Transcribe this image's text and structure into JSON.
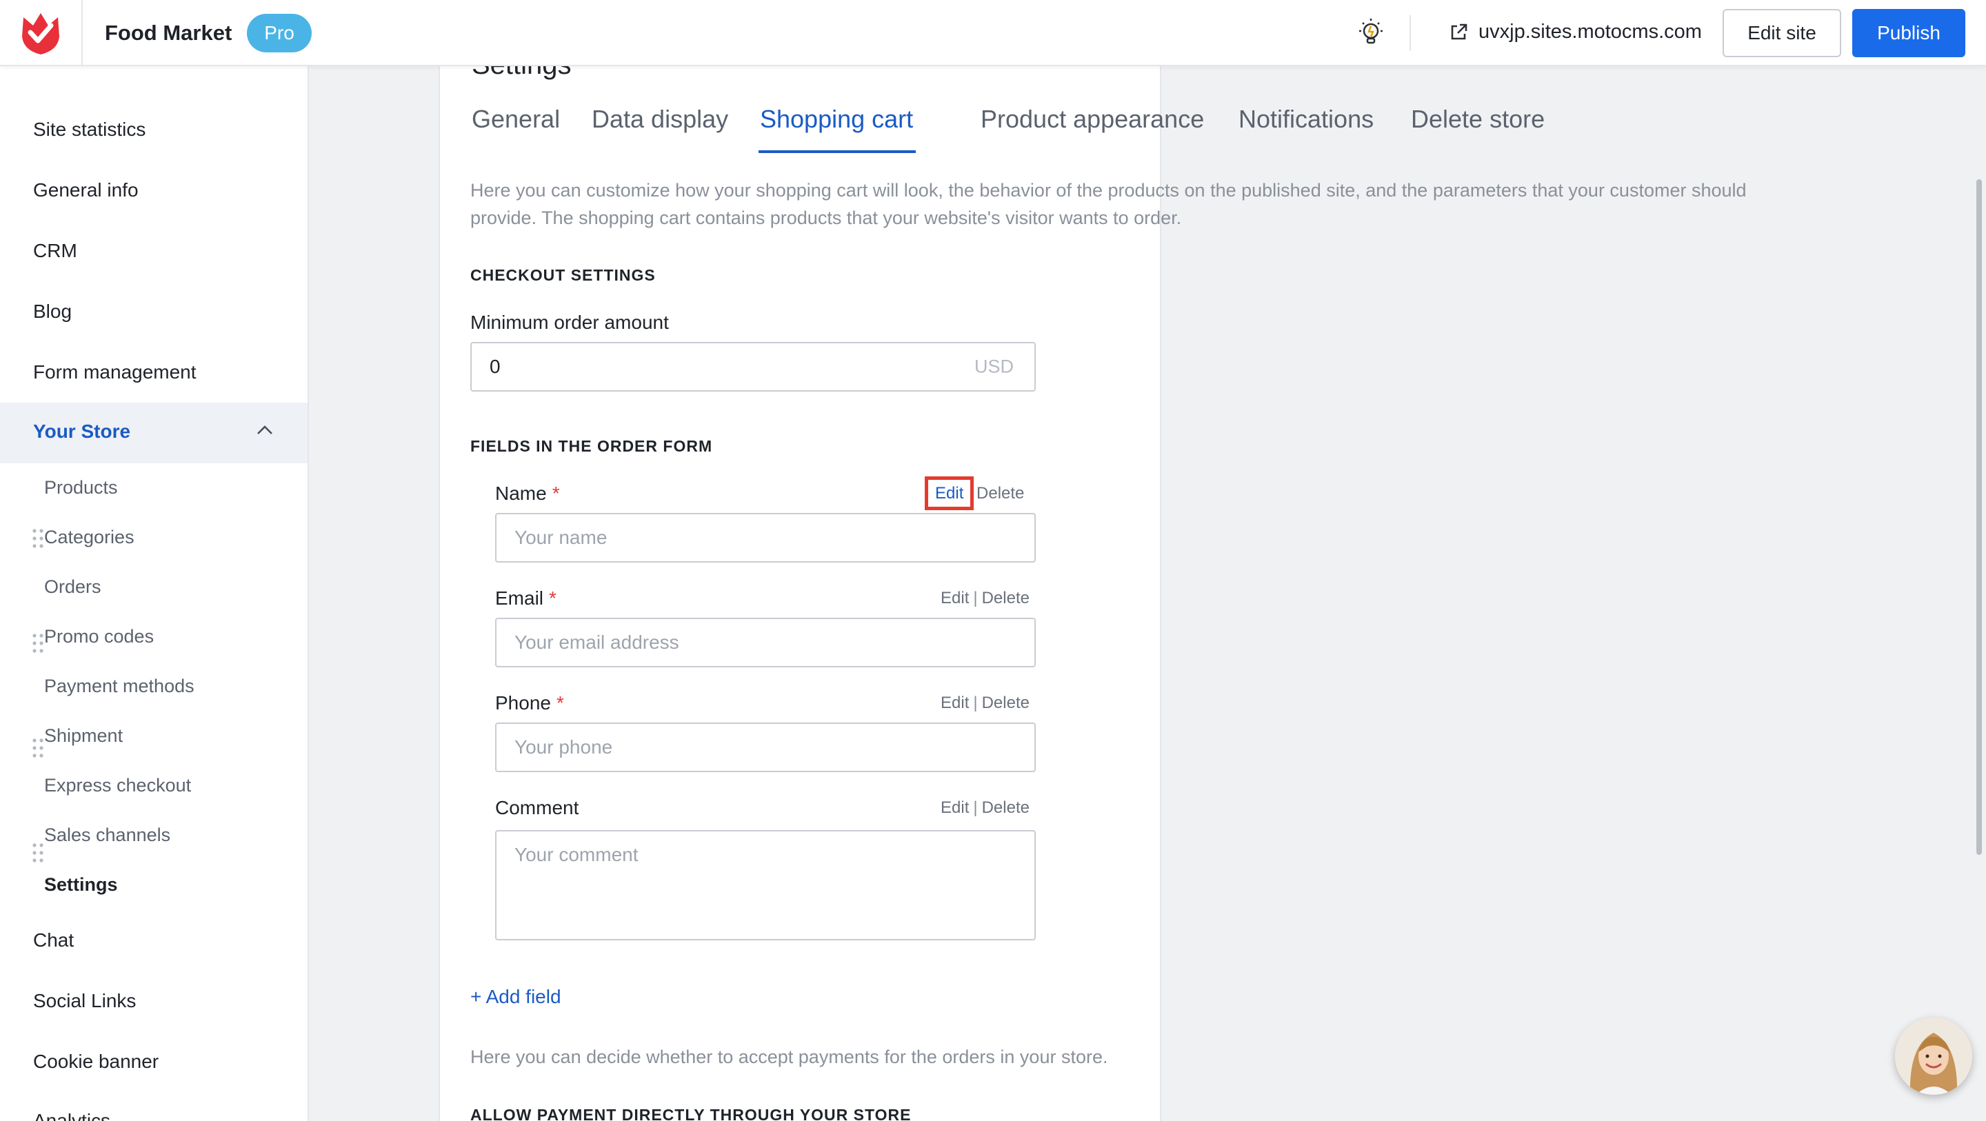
{
  "header": {
    "site_name": "Food Market",
    "plan_badge": "Pro",
    "site_url": "uvxjp.sites.motocms.com",
    "edit_site_label": "Edit site",
    "publish_label": "Publish",
    "accent_color": "#1a6bea"
  },
  "sidebar": {
    "items": [
      {
        "label": "Site statistics"
      },
      {
        "label": "General info"
      },
      {
        "label": "CRM"
      },
      {
        "label": "Blog"
      },
      {
        "label": "Form management"
      }
    ],
    "store": {
      "label": "Your Store",
      "expanded": true,
      "subitems": [
        {
          "label": "Products"
        },
        {
          "label": "Categories"
        },
        {
          "label": "Orders"
        },
        {
          "label": "Promo codes"
        },
        {
          "label": "Payment methods"
        },
        {
          "label": "Shipment"
        },
        {
          "label": "Express checkout"
        },
        {
          "label": "Sales channels"
        },
        {
          "label": "Settings",
          "current": true
        }
      ]
    },
    "items_after": [
      {
        "label": "Chat"
      },
      {
        "label": "Social Links"
      },
      {
        "label": "Cookie banner"
      },
      {
        "label": "Analytics"
      }
    ]
  },
  "main": {
    "title": "Settings",
    "tabs": [
      {
        "label": "General"
      },
      {
        "label": "Data display"
      },
      {
        "label": "Shopping cart",
        "active": true
      },
      {
        "label": "Product appearance"
      },
      {
        "label": "Notifications"
      },
      {
        "label": "Delete store"
      }
    ],
    "intro": "Here you can customize how your shopping cart will look, the behavior of the products on the published site, and the parameters that your customer should provide. The shopping cart contains products that your website's visitor wants to order.",
    "checkout": {
      "heading": "CHECKOUT SETTINGS",
      "min_order_label": "Minimum order amount",
      "min_order_value": "0",
      "currency": "USD"
    },
    "order_form": {
      "heading": "FIELDS IN THE ORDER FORM",
      "edit_label": "Edit",
      "separator": "|",
      "delete_label": "Delete",
      "fields": [
        {
          "label": "Name",
          "required": "*",
          "placeholder": "Your name"
        },
        {
          "label": "Email",
          "required": "*",
          "placeholder": "Your email address"
        },
        {
          "label": "Phone",
          "required": "*",
          "placeholder": "Your phone"
        },
        {
          "label": "Comment",
          "placeholder": "Your comment"
        }
      ],
      "add_field_label": "+ Add field"
    },
    "payments_intro": "Here you can decide whether to accept payments for the orders in your store.",
    "payments_heading": "ALLOW PAYMENT DIRECTLY THROUGH YOUR STORE"
  }
}
